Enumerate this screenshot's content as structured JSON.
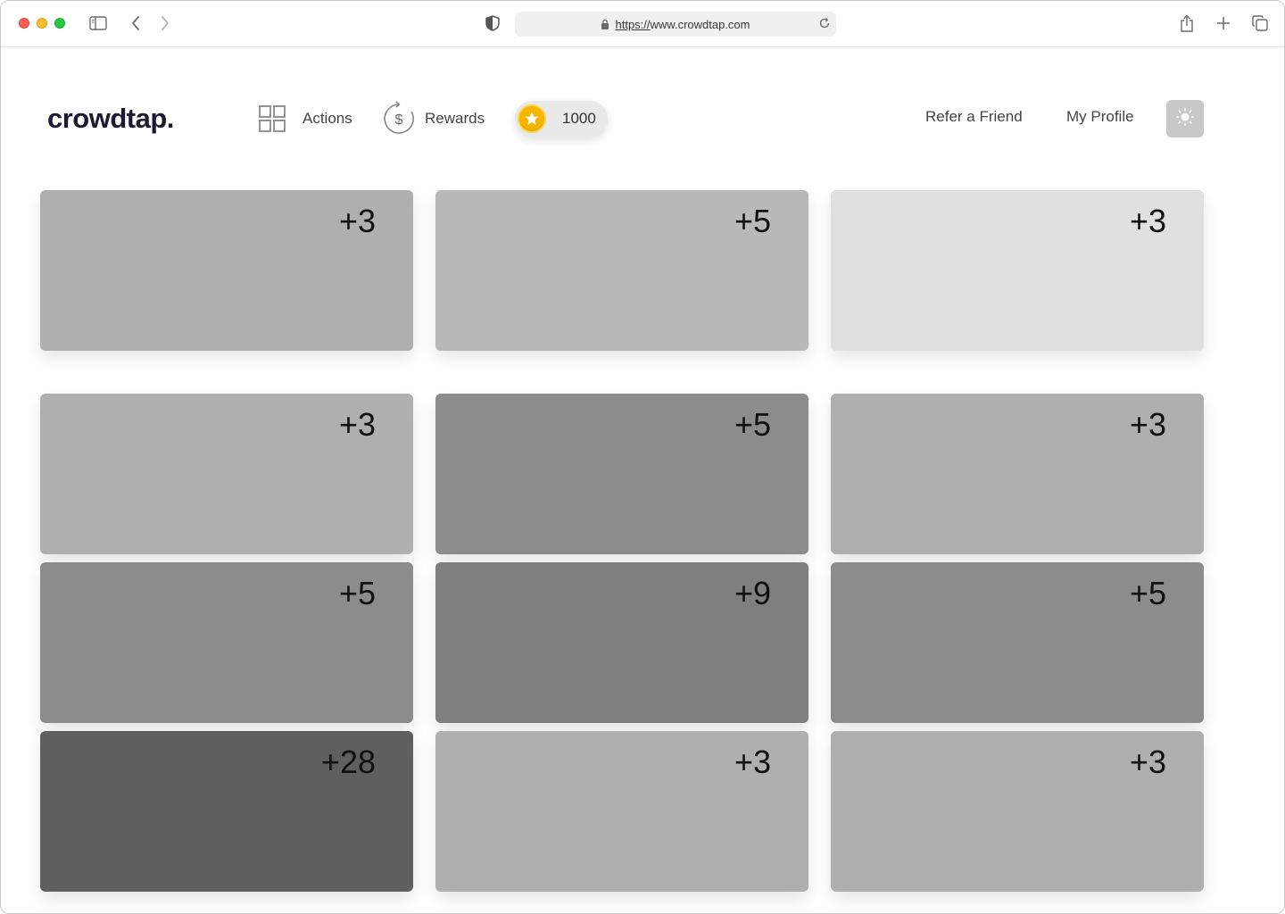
{
  "browser": {
    "url_scheme": "https://",
    "url_host": "www.crowdtap.com"
  },
  "header": {
    "logo": "crowdtap.",
    "nav": {
      "actions_label": "Actions",
      "rewards_label": "Rewards"
    },
    "points_balance": "1000",
    "refer_label": "Refer a Friend",
    "profile_label": "My Profile"
  },
  "cards": [
    {
      "points": "+3",
      "color": "#afafaf"
    },
    {
      "points": "+5",
      "color": "#b9b9b9"
    },
    {
      "points": "+3",
      "color": "#e0e0e0"
    },
    {
      "points": "+3",
      "color": "#afafaf"
    },
    {
      "points": "+5",
      "color": "#8c8c8c"
    },
    {
      "points": "+3",
      "color": "#afafaf"
    },
    {
      "points": "+5",
      "color": "#8c8c8c"
    },
    {
      "points": "+9",
      "color": "#7f7f7f"
    },
    {
      "points": "+5",
      "color": "#8c8c8c"
    },
    {
      "points": "+28",
      "color": "#5f5f5f"
    },
    {
      "points": "+3",
      "color": "#afafaf"
    },
    {
      "points": "+3",
      "color": "#afafaf"
    }
  ]
}
